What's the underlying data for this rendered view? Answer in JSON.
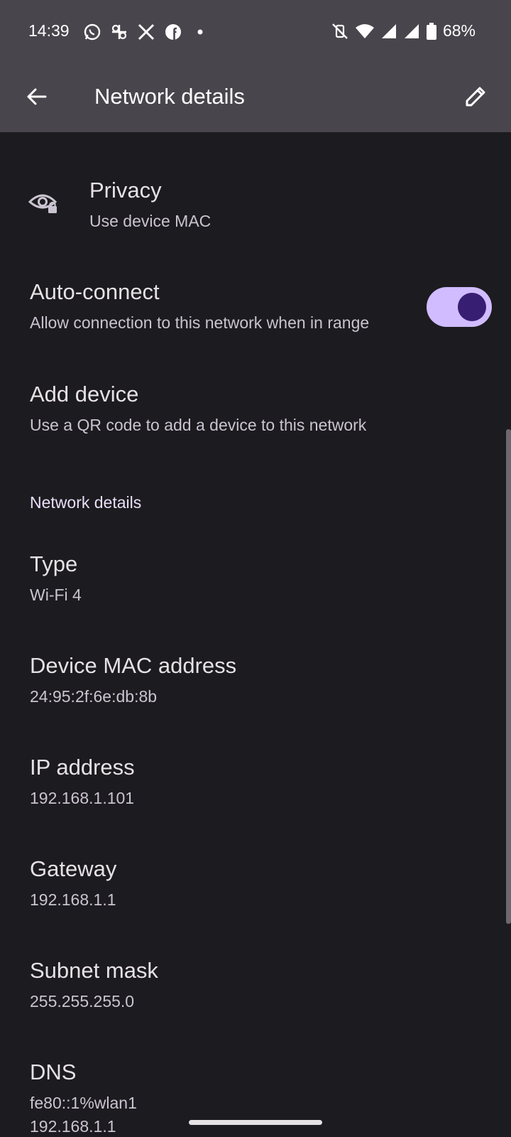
{
  "status_bar": {
    "time": "14:39",
    "battery": "68%",
    "notification_icons": [
      "whatsapp-icon",
      "threads-icon",
      "x-icon",
      "facebook-icon",
      "dot-icon"
    ],
    "system_icons": [
      "vibrate-off-icon",
      "wifi-icon",
      "signal-icon",
      "signal-icon",
      "battery-icon"
    ]
  },
  "app_bar": {
    "title": "Network details"
  },
  "settings": {
    "privacy": {
      "title": "Privacy",
      "subtitle": "Use device MAC"
    },
    "auto_connect": {
      "title": "Auto-connect",
      "subtitle": "Allow connection to this network when in range",
      "enabled": true
    },
    "add_device": {
      "title": "Add device",
      "subtitle": "Use a QR code to add a device to this network"
    }
  },
  "details": {
    "section_title": "Network details",
    "type": {
      "label": "Type",
      "value": "Wi-Fi 4"
    },
    "mac": {
      "label": "Device MAC address",
      "value": "24:95:2f:6e:db:8b"
    },
    "ip": {
      "label": "IP address",
      "value": "192.168.1.101"
    },
    "gateway": {
      "label": "Gateway",
      "value": "192.168.1.1"
    },
    "subnet": {
      "label": "Subnet mask",
      "value": "255.255.255.0"
    },
    "dns": {
      "label": "DNS",
      "value1": "fe80::1%wlan1",
      "value2": "192.168.1.1"
    }
  },
  "colors": {
    "background": "#1c1b1f",
    "topbar": "#48464c",
    "accent": "#d0bcff",
    "toggle_knob": "#381e72"
  }
}
